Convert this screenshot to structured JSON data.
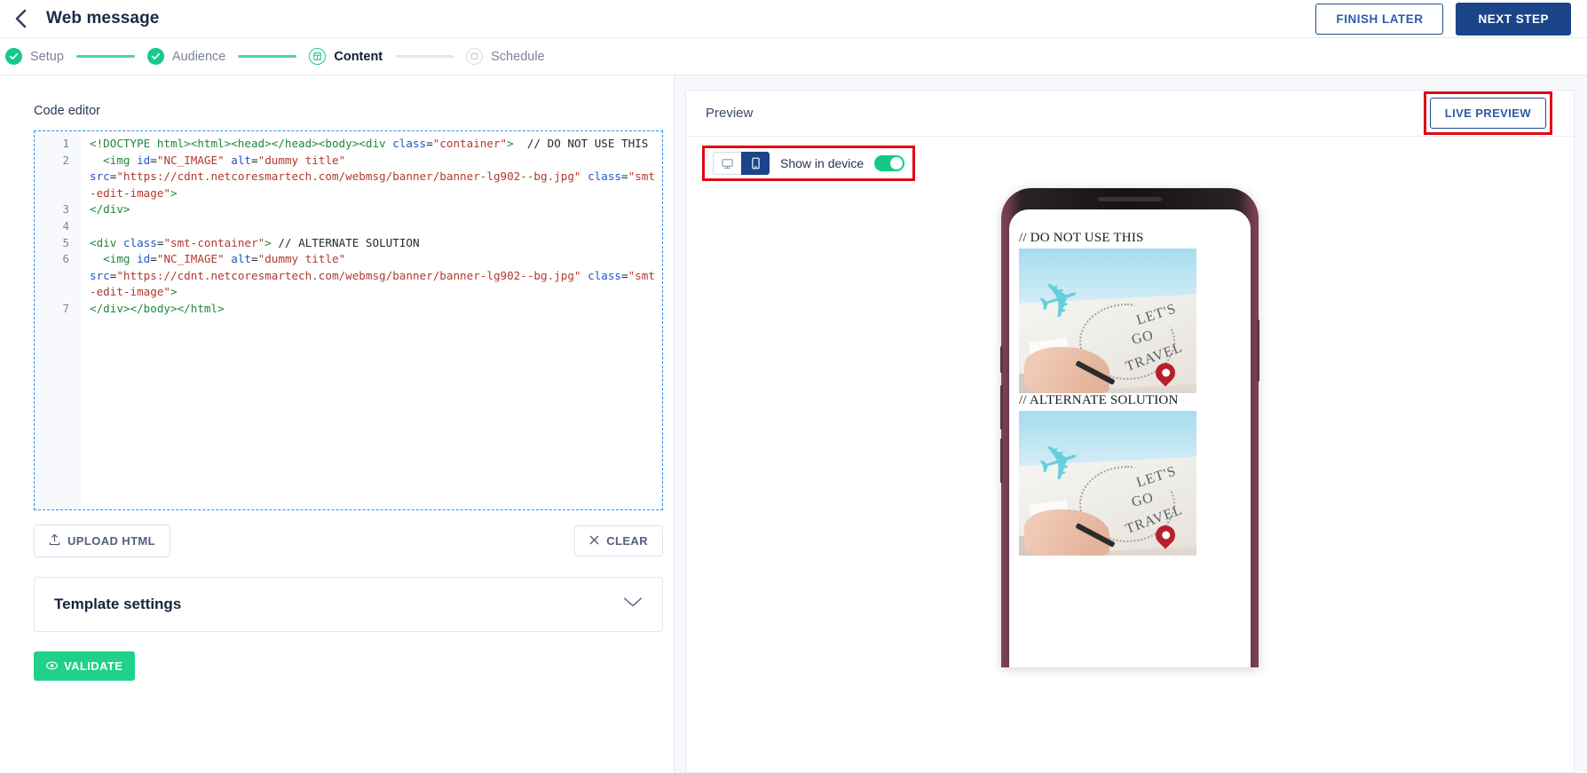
{
  "header": {
    "title": "Web message",
    "back_icon": "chevron-left-icon",
    "finish_later_label": "FINISH LATER",
    "next_step_label": "NEXT STEP",
    "next_step_color": "#1b4489"
  },
  "stepper": {
    "steps": [
      {
        "label": "Setup",
        "state": "done",
        "icon": "check-icon"
      },
      {
        "label": "Audience",
        "state": "done",
        "icon": "check-icon"
      },
      {
        "label": "Content",
        "state": "current",
        "icon": "content-square-icon"
      },
      {
        "label": "Schedule",
        "state": "todo",
        "icon": "schedule-square-icon"
      }
    ],
    "done_color": "#17c98b",
    "line_color": "#4ad6a4"
  },
  "editor": {
    "title": "Code editor",
    "line_numbers": [
      "1",
      "2",
      "3",
      "4",
      "5",
      "6",
      "7"
    ],
    "code_lines": [
      "<!DOCTYPE html><html><head></head><body><div class=\"container\">  // DO NOT USE THIS",
      "  <img id=\"NC_IMAGE\" alt=\"dummy title\" src=\"https://cdnt.netcoresmartech.com/webmsg/banner/banner-lg902--bg.jpg\" class=\"smt-edit-image\">",
      "</div>",
      "",
      "<div class=\"smt-container\"> // ALTERNATE SOLUTION",
      "  <img id=\"NC_IMAGE\" alt=\"dummy title\" src=\"https://cdnt.netcoresmartech.com/webmsg/banner/banner-lg902--bg.jpg\" class=\"smt-edit-image\">",
      "</div></body></html>"
    ],
    "upload_label": "UPLOAD HTML",
    "upload_icon": "upload-icon",
    "clear_label": "CLEAR",
    "clear_icon": "close-icon",
    "template_settings_label": "Template settings",
    "template_settings_chevron": "chevron-down-icon",
    "validate_label": "VALIDATE",
    "validate_icon": "eye-icon",
    "validate_color": "#1fd18a"
  },
  "preview": {
    "title": "Preview",
    "live_preview_label": "LIVE PREVIEW",
    "highlight_color": "#e30613",
    "device_toggle": {
      "desktop_icon": "desktop-icon",
      "mobile_icon": "mobile-icon",
      "selected": "mobile",
      "show_in_device_label": "Show in device",
      "toggle_on": true,
      "toggle_color": "#12c985"
    },
    "device": {
      "type": "mobile-phone-mockup",
      "messages": [
        {
          "caption": "// DO NOT USE THIS",
          "image_alt": "dummy title",
          "banner_text": [
            "LET'S",
            "GO",
            "TRAVEL"
          ]
        },
        {
          "caption": "// ALTERNATE SOLUTION",
          "image_alt": "dummy title",
          "banner_text": [
            "LET'S",
            "GO",
            "TRAVEL"
          ]
        }
      ]
    }
  }
}
